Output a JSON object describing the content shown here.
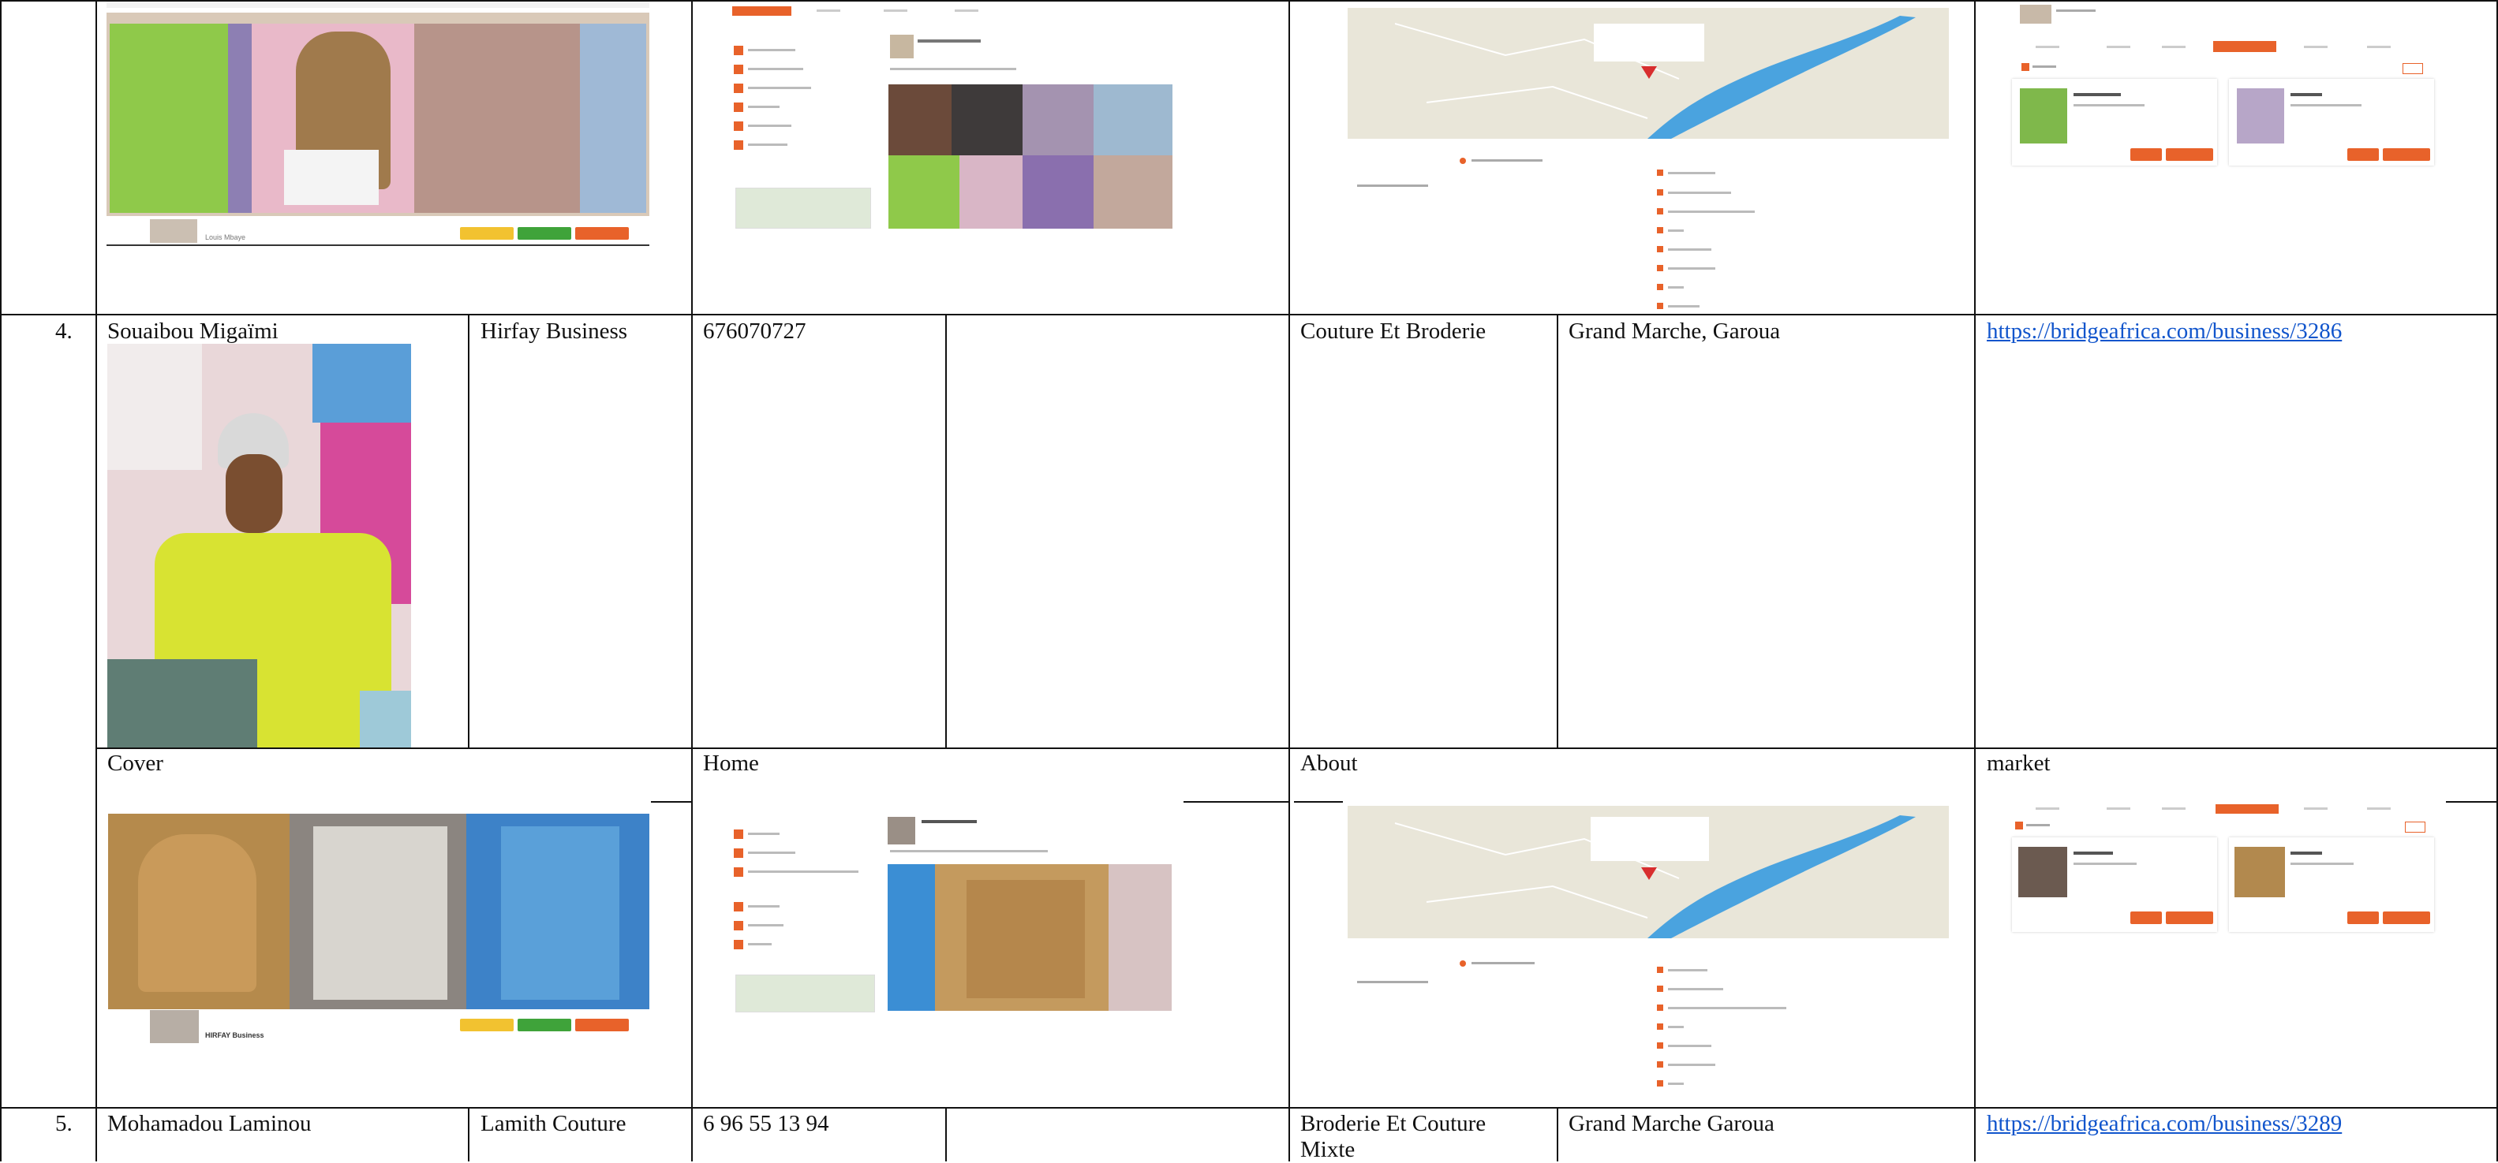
{
  "rows": [
    {
      "number": "4.",
      "name": "Souaibou Migaïmi",
      "business": "Hirfay Business",
      "phone": "676070727",
      "activity": "Couture Et Broderie",
      "location": "Grand Marche, Garoua",
      "url": "https://bridgeafrica.com/business/3286",
      "sub_headers": [
        "Cover",
        "Home",
        "About",
        "market"
      ]
    },
    {
      "number": "5.",
      "name": "Mohamadou Laminou",
      "business": "Lamith Couture",
      "phone": "6 96 55 13 94",
      "activity_line1": "Broderie Et Couture",
      "activity_line2": "Mixte",
      "location": "Grand Marche Garoua",
      "url": "https://bridgeafrica.com/business/3289"
    }
  ],
  "colors": {
    "link": "#1155cc",
    "brand_orange": "#e8622a",
    "button_yellow": "#f2c230",
    "button_green": "#3fa33a",
    "map_water": "#4aa3df"
  }
}
